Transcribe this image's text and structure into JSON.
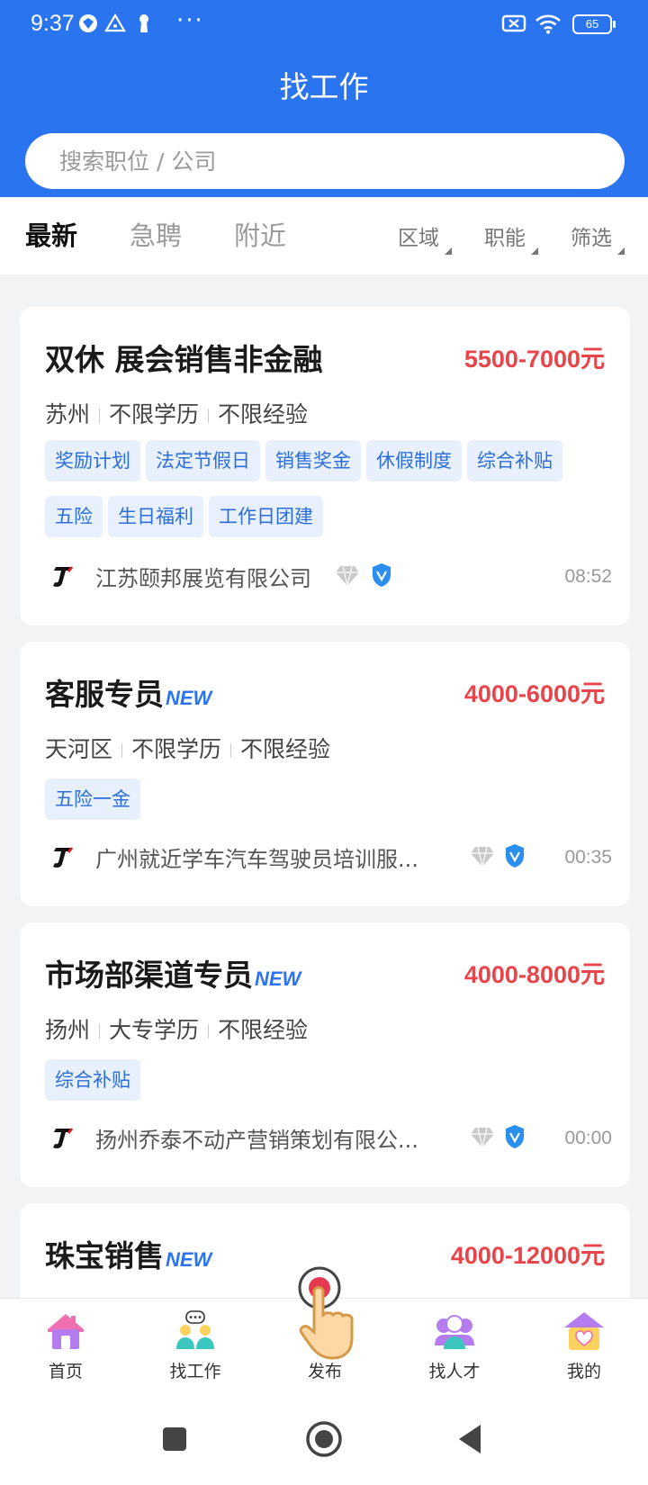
{
  "status_bar": {
    "time": "9:37",
    "battery": "65"
  },
  "header": {
    "title": "找工作"
  },
  "search": {
    "placeholder": "搜索职位 / 公司"
  },
  "tabs": [
    {
      "label": "最新"
    },
    {
      "label": "急聘"
    },
    {
      "label": "附近"
    }
  ],
  "filters": [
    {
      "label": "区域"
    },
    {
      "label": "职能"
    },
    {
      "label": "筛选"
    }
  ],
  "jobs": [
    {
      "title": "双休 展会销售非金融",
      "is_new": false,
      "salary": "5500-7000元",
      "location": "苏州",
      "education": "不限学历",
      "experience": "不限经验",
      "tags": [
        "奖励计划",
        "法定节假日",
        "销售奖金",
        "休假制度",
        "综合补贴",
        "五险",
        "生日福利",
        "工作日团建"
      ],
      "company": "江苏颐邦展览有限公司",
      "time": "08:52"
    },
    {
      "title": "客服专员",
      "is_new": true,
      "salary": "4000-6000元",
      "location": "天河区",
      "education": "不限学历",
      "experience": "不限经验",
      "tags": [
        "五险一金"
      ],
      "company": "广州就近学车汽车驾驶员培训服...",
      "time": "00:35"
    },
    {
      "title": "市场部渠道专员",
      "is_new": true,
      "salary": "4000-8000元",
      "location": "扬州",
      "education": "大专学历",
      "experience": "不限经验",
      "tags": [
        "综合补贴"
      ],
      "company": "扬州乔泰不动产营销策划有限公...",
      "time": "00:00"
    },
    {
      "title": "珠宝销售",
      "is_new": true,
      "salary": "4000-12000元"
    }
  ],
  "new_badge": "NEW",
  "bottom_nav": [
    {
      "label": "首页",
      "icon": "home-icon"
    },
    {
      "label": "找工作",
      "icon": "find-job-icon"
    },
    {
      "label": "发布",
      "icon": "publish-icon"
    },
    {
      "label": "找人才",
      "icon": "find-talent-icon"
    },
    {
      "label": "我的",
      "icon": "profile-icon"
    }
  ],
  "colors": {
    "primary": "#2b74ef",
    "salary": "#e8454b",
    "tag_bg": "#e8f0fd",
    "tag_text": "#2b6ed8"
  }
}
